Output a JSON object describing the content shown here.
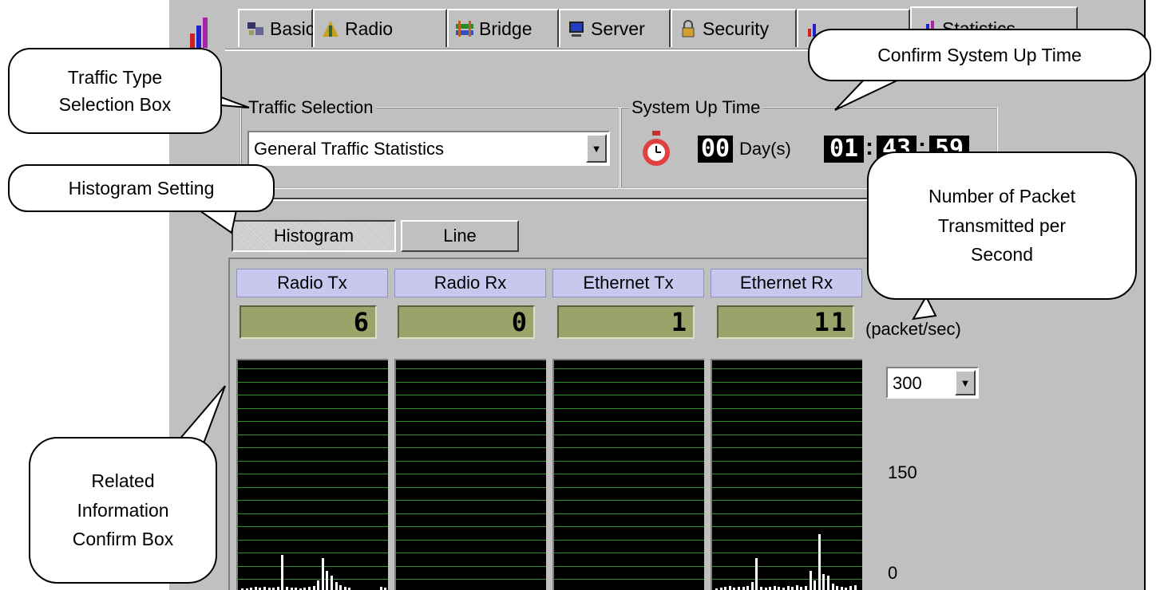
{
  "tabs": [
    {
      "label": "Basic",
      "icon": "basic-icon"
    },
    {
      "label": "Radio",
      "icon": "radio-icon"
    },
    {
      "label": "Bridge",
      "icon": "bridge-icon"
    },
    {
      "label": "Server",
      "icon": "server-icon"
    },
    {
      "label": "Security",
      "icon": "lock-icon"
    },
    {
      "label": "Statistics",
      "icon": "statistics-icon"
    }
  ],
  "traffic": {
    "group_title": "Traffic Selection",
    "selected": "General Traffic Statistics"
  },
  "uptime": {
    "group_title": "System Up Time",
    "days": "00",
    "days_label": "Day(s)",
    "clock_h": "01",
    "clock_m": "43",
    "clock_s": "59"
  },
  "view_buttons": {
    "histogram": "Histogram",
    "line": "Line"
  },
  "channels": [
    {
      "name": "Radio Tx",
      "value": "6"
    },
    {
      "name": "Radio Rx",
      "value": "0"
    },
    {
      "name": "Ethernet Tx",
      "value": "1"
    },
    {
      "name": "Ethernet Rx",
      "value": "11"
    }
  ],
  "unit_label": "(packet/sec)",
  "scale": {
    "selected": "300",
    "mid": "150",
    "min": "0"
  },
  "callouts": {
    "traffic_type_l1": "Traffic Type",
    "traffic_type_l2": "Selection Box",
    "confirm_uptime": "Confirm System Up Time",
    "histogram_setting": "Histogram Setting",
    "packet_l1": "Number of Packet",
    "packet_l2": "Transmitted per",
    "packet_l3": "Second",
    "related_l1": "Related",
    "related_l2": "Information",
    "related_l3": "Confirm Box"
  },
  "colors": {
    "lcd_bg": "#9aa36a",
    "channel_header": "#c8c8ee",
    "grid": "#2e8f2e"
  }
}
